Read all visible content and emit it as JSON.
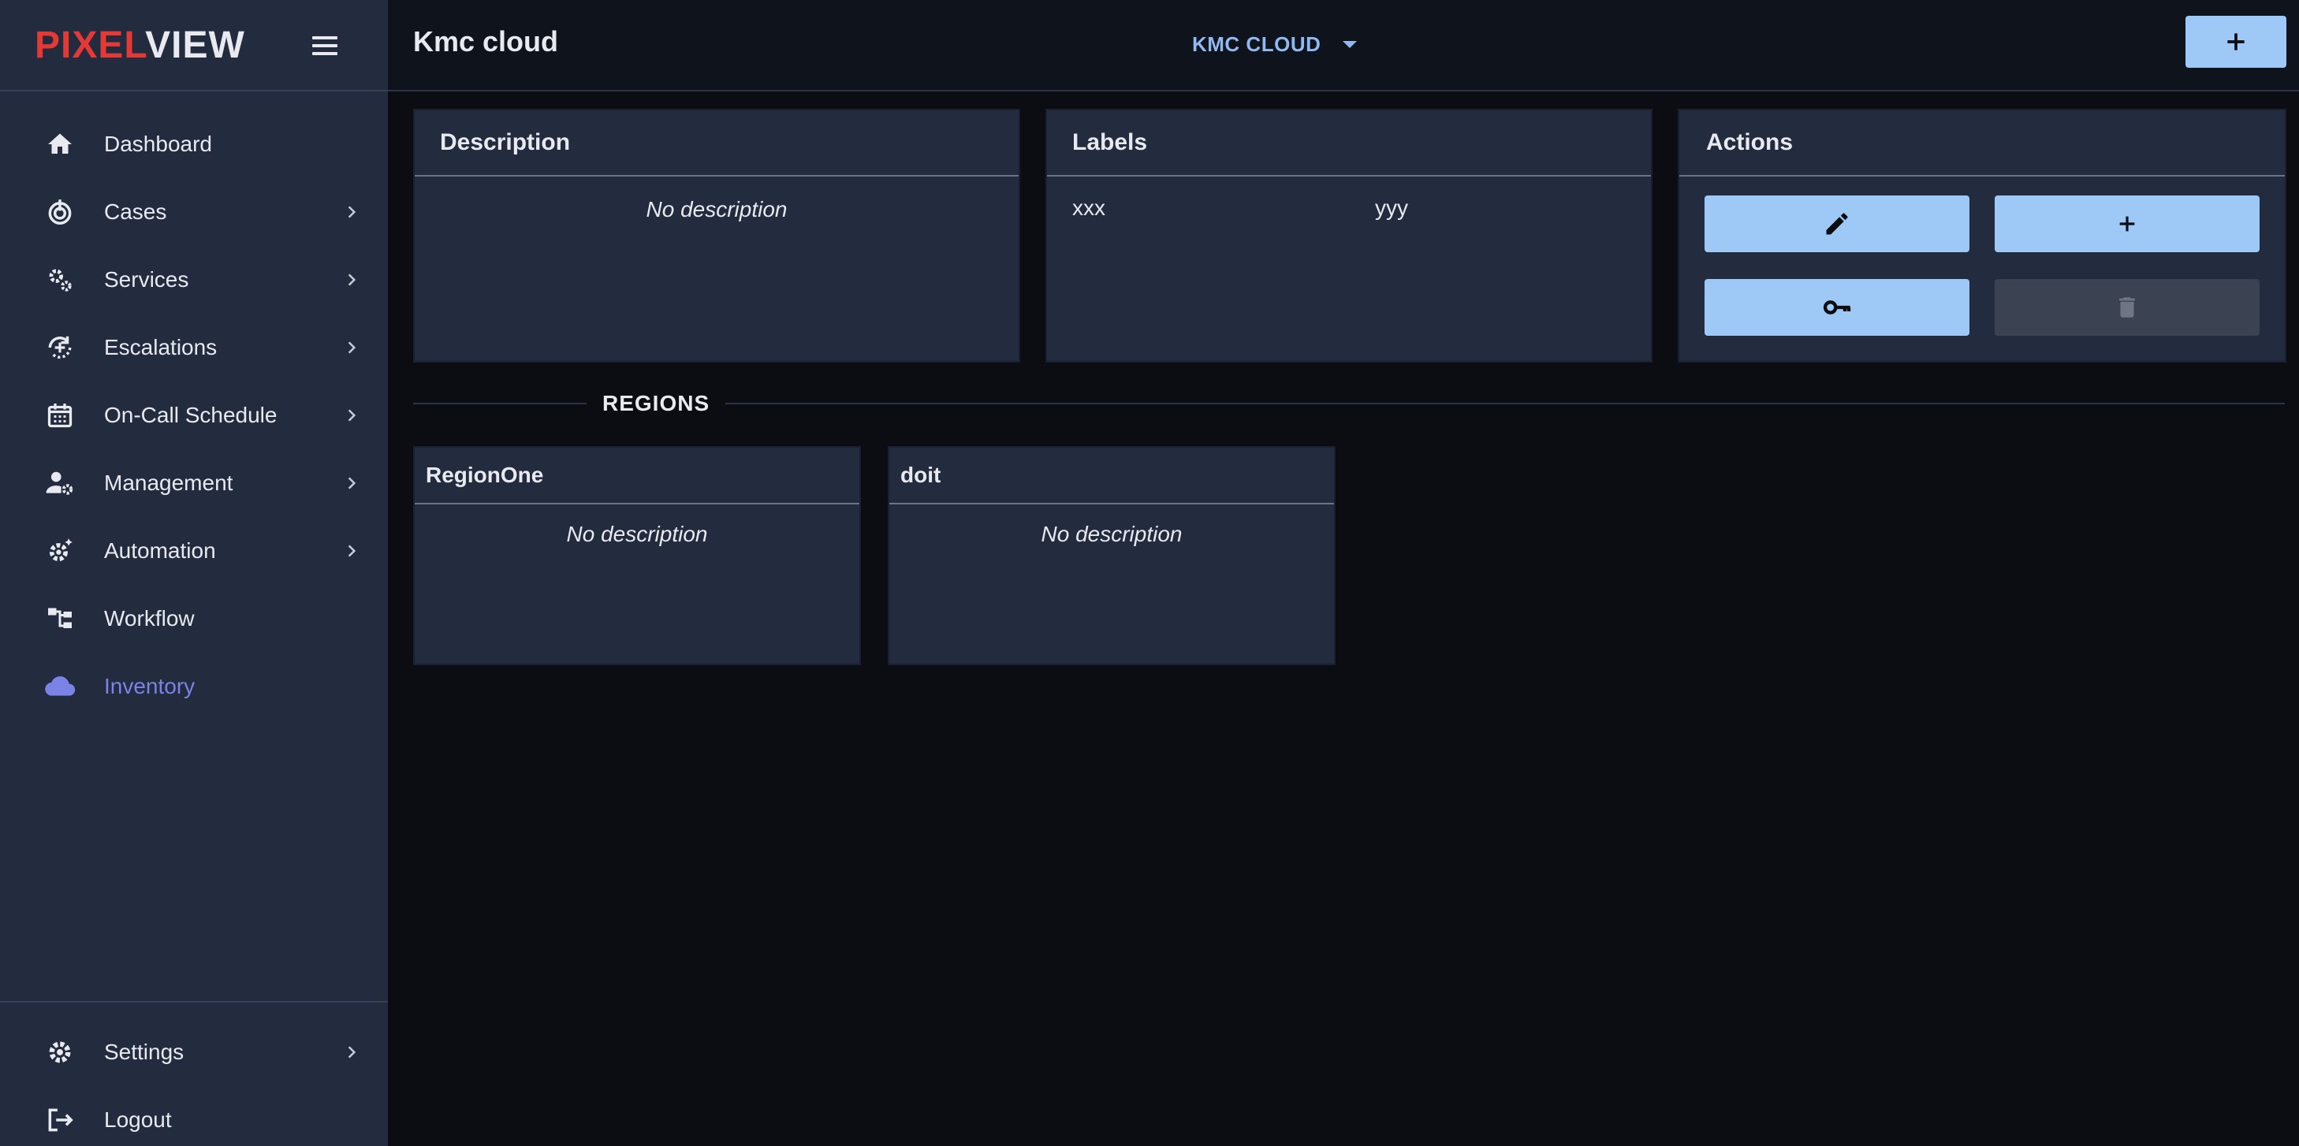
{
  "brand": {
    "logo_red": "PIXEL",
    "logo_white": "VIEW"
  },
  "sidebar": {
    "items": [
      {
        "label": "Dashboard",
        "icon": "home-icon",
        "has_submenu": false,
        "active": false
      },
      {
        "label": "Cases",
        "icon": "target-icon",
        "has_submenu": true,
        "active": false
      },
      {
        "label": "Services",
        "icon": "gears-icon",
        "has_submenu": true,
        "active": false
      },
      {
        "label": "Escalations",
        "icon": "escalation-icon",
        "has_submenu": true,
        "active": false
      },
      {
        "label": "On-Call Schedule",
        "icon": "calendar-icon",
        "has_submenu": true,
        "active": false
      },
      {
        "label": "Management",
        "icon": "user-gear-icon",
        "has_submenu": true,
        "active": false
      },
      {
        "label": "Automation",
        "icon": "automation-gear-icon",
        "has_submenu": true,
        "active": false
      },
      {
        "label": "Workflow",
        "icon": "workflow-icon",
        "has_submenu": false,
        "active": false
      },
      {
        "label": "Inventory",
        "icon": "cloud-icon",
        "has_submenu": false,
        "active": true
      }
    ],
    "footer": [
      {
        "label": "Settings",
        "icon": "settings-gear-icon",
        "has_submenu": true
      },
      {
        "label": "Logout",
        "icon": "logout-icon",
        "has_submenu": false
      }
    ]
  },
  "header": {
    "title": "Kmc cloud",
    "context_selector": "KMC CLOUD"
  },
  "description_card": {
    "title": "Description",
    "text": "No description"
  },
  "labels_card": {
    "title": "Labels",
    "labels": [
      "xxx",
      "yyy"
    ]
  },
  "actions_card": {
    "title": "Actions",
    "buttons": [
      {
        "icon": "pencil-icon",
        "enabled": true
      },
      {
        "icon": "plus-icon",
        "enabled": true
      },
      {
        "icon": "key-icon",
        "enabled": true
      },
      {
        "icon": "trash-icon",
        "enabled": false
      }
    ]
  },
  "regions": {
    "heading": "REGIONS",
    "items": [
      {
        "name": "RegionOne",
        "description": "No description"
      },
      {
        "name": "doit",
        "description": "No description"
      }
    ]
  },
  "colors": {
    "accent_button": "#9ec9f7",
    "active_nav": "#7b83e6",
    "logo_red": "#e53935",
    "context_text": "#8fb9f0"
  }
}
